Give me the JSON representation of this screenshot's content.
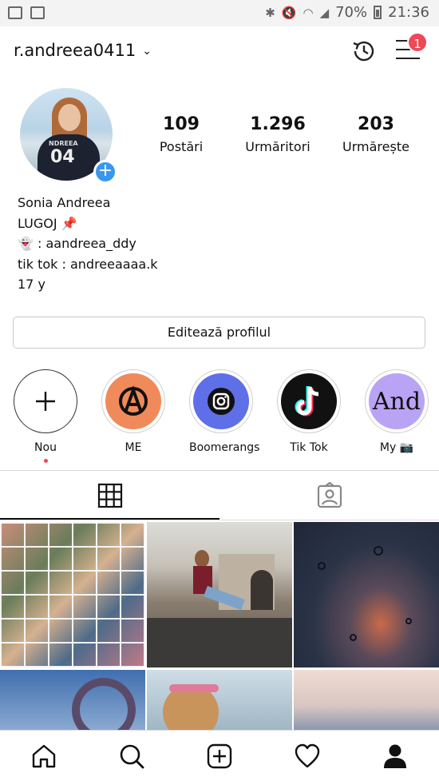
{
  "status_bar": {
    "battery": "70%",
    "time": "21:36"
  },
  "header": {
    "username": "r.andreea0411",
    "notifications_badge": "1"
  },
  "profile": {
    "stats": [
      {
        "value": "109",
        "label": "Postări"
      },
      {
        "value": "1.296",
        "label": "Urmăritori"
      },
      {
        "value": "203",
        "label": "Urmărește"
      }
    ],
    "bio": [
      "Sonia Andreea",
      "LUGOJ 📌",
      "👻 : aandreea_ddy",
      "tik tok : andreeaaaa.k",
      "17 y"
    ],
    "edit_button": "Editează profilul"
  },
  "highlights": [
    {
      "label": "Nou"
    },
    {
      "label": "ME"
    },
    {
      "label": "Boomerangs"
    },
    {
      "label": "Tik Tok"
    },
    {
      "label": "My 📷"
    }
  ],
  "colors": {
    "accent": "#3897f0",
    "badge": "#ed4956",
    "me_highlight": "#f08a5a",
    "boomerangs_highlight": "#5f6fe8",
    "my_highlight": "#b9a3f5"
  },
  "icons": [
    "history-icon",
    "menu-icon",
    "grid-icon",
    "tagged-icon",
    "home-icon",
    "search-icon",
    "add-post-icon",
    "heart-icon",
    "profile-icon"
  ]
}
